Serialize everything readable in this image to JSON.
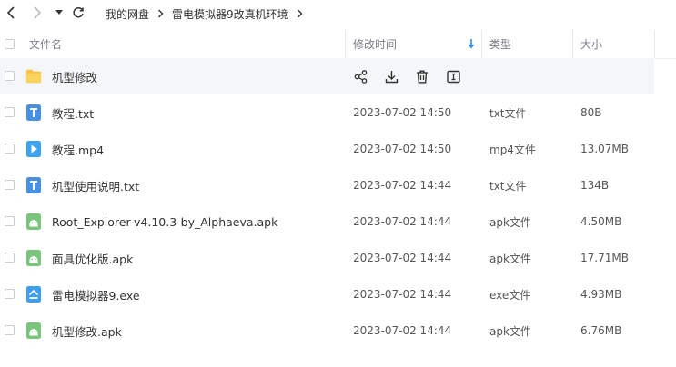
{
  "nav": {
    "breadcrumbs": [
      "我的网盘",
      "雷电模拟器9改真机环境"
    ]
  },
  "columns": {
    "name": "文件名",
    "modified": "修改时间",
    "type": "类型",
    "size": "大小"
  },
  "colors": {
    "folder": "#f7c543",
    "txt": "#4a90e2",
    "video": "#3ea2f2",
    "apk": "#7ac47b",
    "exe": "#3e9ff2",
    "sort_arrow": "#2e8df0"
  },
  "files": [
    {
      "icon": "folder-icon",
      "name": "机型修改",
      "time": "",
      "type": "",
      "size": ""
    },
    {
      "icon": "txt-file-icon",
      "name": "教程.txt",
      "time": "2023-07-02 14:50",
      "type": "txt文件",
      "size": "80B"
    },
    {
      "icon": "video-file-icon",
      "name": "教程.mp4",
      "time": "2023-07-02 14:50",
      "type": "mp4文件",
      "size": "13.07MB"
    },
    {
      "icon": "txt-file-icon",
      "name": "机型使用说明.txt",
      "time": "2023-07-02 14:44",
      "type": "txt文件",
      "size": "134B"
    },
    {
      "icon": "apk-file-icon",
      "name": "Root_Explorer-v4.10.3-by_Alphaeva.apk",
      "time": "2023-07-02 14:44",
      "type": "apk文件",
      "size": "4.50MB"
    },
    {
      "icon": "apk-file-icon",
      "name": "面具优化版.apk",
      "time": "2023-07-02 14:44",
      "type": "apk文件",
      "size": "17.71MB"
    },
    {
      "icon": "exe-file-icon",
      "name": "雷电模拟器9.exe",
      "time": "2023-07-02 14:44",
      "type": "exe文件",
      "size": "4.93MB"
    },
    {
      "icon": "apk-file-icon",
      "name": "机型修改.apk",
      "time": "2023-07-02 14:44",
      "type": "apk文件",
      "size": "6.76MB"
    }
  ],
  "row_actions": [
    "share-icon",
    "download-icon",
    "delete-icon",
    "rename-icon"
  ]
}
